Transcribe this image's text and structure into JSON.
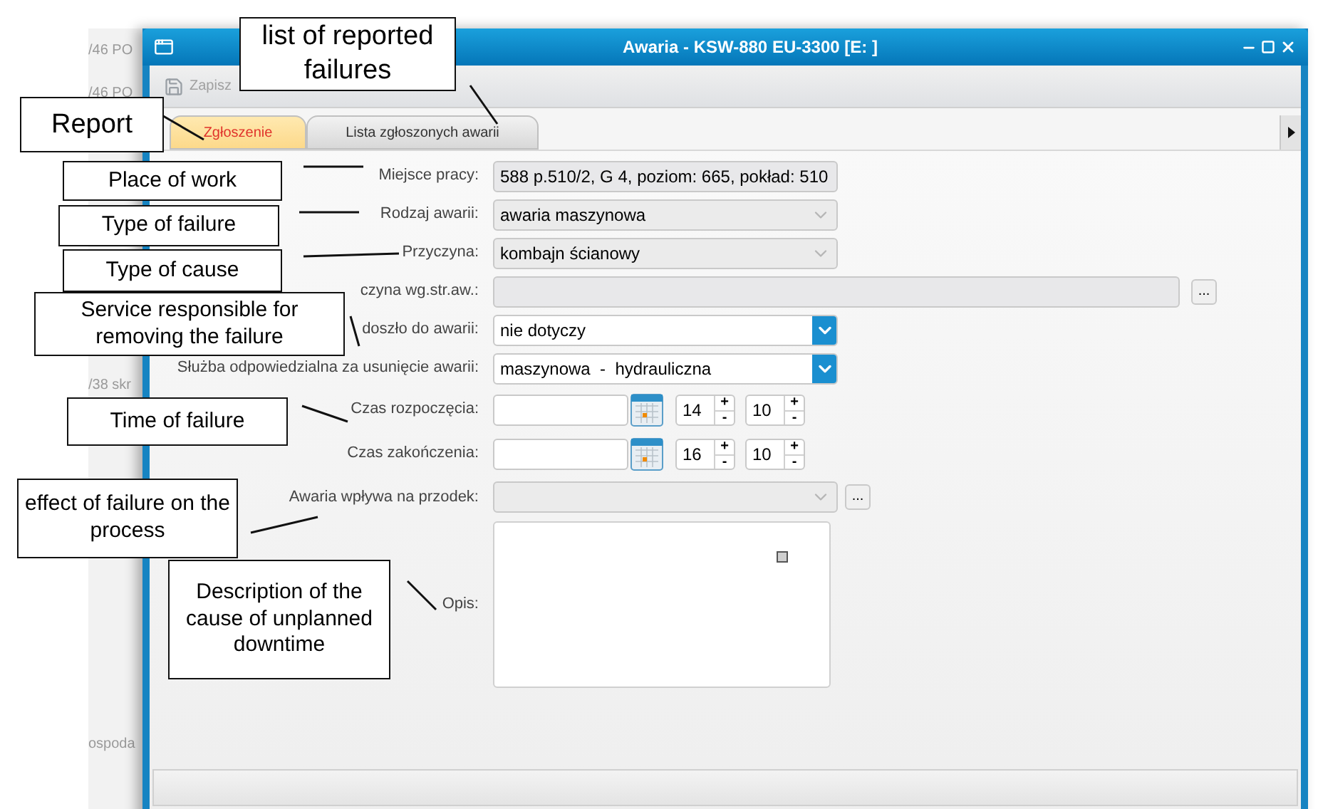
{
  "background_list": [
    {
      "text": "/46 PO"
    },
    {
      "text": "/46 PO"
    },
    {
      "text": "/38 skr"
    },
    {
      "text": "ospoda"
    }
  ],
  "window": {
    "title": "Awaria - KSW-880 EU-3300 [E: ]"
  },
  "toolbar": [
    {
      "label": "Zapisz",
      "disabled": true
    }
  ],
  "tabs": [
    {
      "label": "Zgłoszenie",
      "selected": true
    },
    {
      "label": "Lista zgłoszonych awarii",
      "selected": false
    }
  ],
  "form": [
    {
      "kind": "readonly",
      "label": "Miejsce pracy:",
      "value": "588 p.510/2, G 4, poziom: 665, pokład: 510"
    },
    {
      "kind": "combo",
      "label": "Rodzaj awarii:",
      "value": "awaria maszynowa",
      "disabled": true
    },
    {
      "kind": "combo",
      "label": "Przyczyna:",
      "value": "kombajn ścianowy",
      "disabled": true
    },
    {
      "kind": "lookup",
      "label": "czyna wg.str.aw.:",
      "button": "..."
    },
    {
      "kind": "combo",
      "label": "doszło do awarii:",
      "value": "nie dotyczy",
      "disabled": false
    },
    {
      "kind": "combo",
      "label": "Służba odpowiedzialna za usunięcie awarii:",
      "value": "maszynowa  -  hydrauliczna",
      "disabled": false
    },
    {
      "kind": "datetime",
      "label": "Czas rozpoczęcia:",
      "hour": "14",
      "minute": "10",
      "plus": "+",
      "minus": "-"
    },
    {
      "kind": "datetime",
      "label": "Czas zakończenia:",
      "hour": "16",
      "minute": "10",
      "plus": "+",
      "minus": "-"
    },
    {
      "kind": "combo_lookup",
      "label": "Awaria wpływa na przodek:",
      "disabled": true,
      "button": "..."
    },
    {
      "kind": "textarea",
      "label": "Opis:"
    }
  ],
  "annotations": [
    {
      "text": "list of reported failures"
    },
    {
      "text": "Report"
    },
    {
      "text": "Place of work"
    },
    {
      "text": "Type of failure"
    },
    {
      "text": "Type of cause"
    },
    {
      "text": "Service responsible for removing the failure"
    },
    {
      "text": "Time of failure"
    },
    {
      "text": "effect of failure on the process"
    },
    {
      "text": "Description of the cause of unplanned downtime"
    }
  ]
}
